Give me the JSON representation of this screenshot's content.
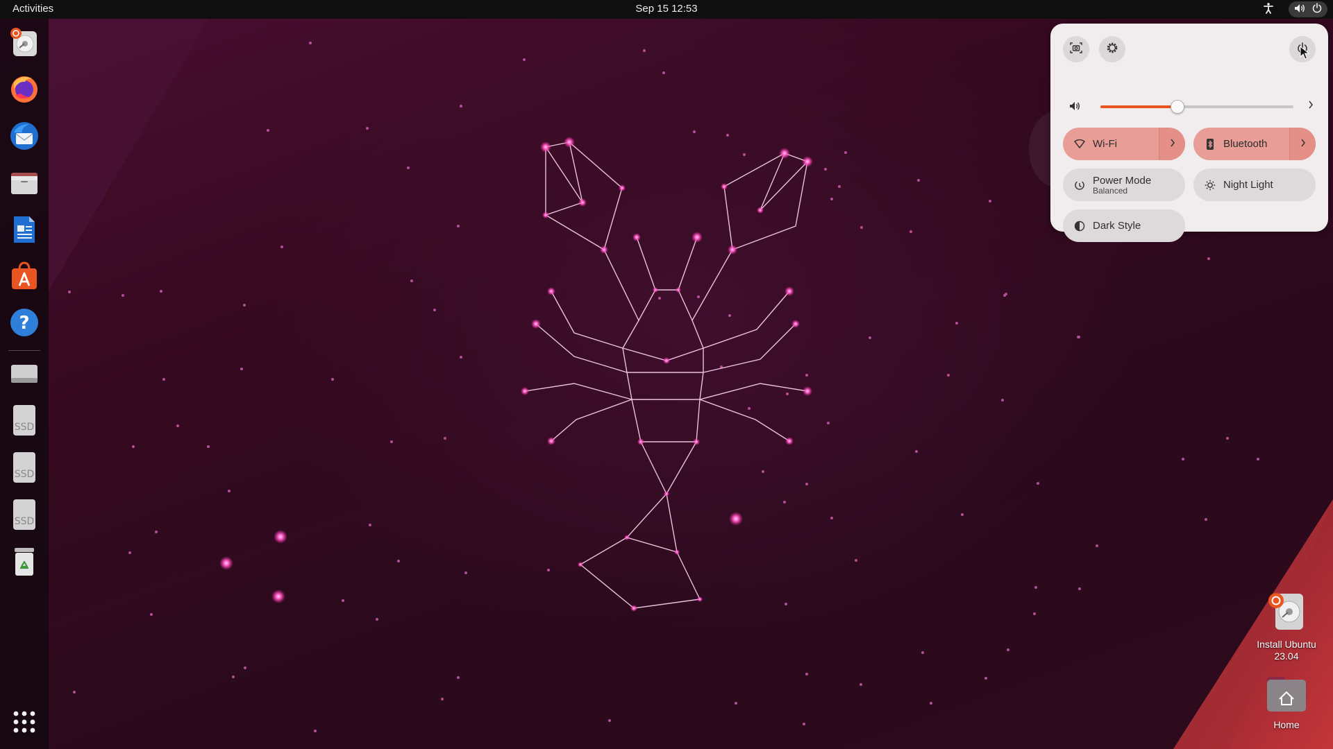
{
  "topbar": {
    "activities": "Activities",
    "datetime": "Sep 15  12:53"
  },
  "dock": {
    "items": [
      {
        "name": "Install Ubuntu",
        "icon": "ubuntu-installer-icon"
      },
      {
        "name": "Firefox",
        "icon": "firefox-icon"
      },
      {
        "name": "Thunderbird",
        "icon": "thunderbird-icon"
      },
      {
        "name": "Files",
        "icon": "files-icon"
      },
      {
        "name": "LibreOffice Writer",
        "icon": "writer-icon"
      },
      {
        "name": "App Center",
        "icon": "app-center-icon"
      },
      {
        "name": "Help",
        "icon": "help-icon"
      },
      {
        "name": "Drive",
        "icon": "drive-icon"
      },
      {
        "name": "SSD",
        "icon": "ssd-icon",
        "label": "SSD"
      },
      {
        "name": "SSD",
        "icon": "ssd-icon",
        "label": "SSD"
      },
      {
        "name": "SSD",
        "icon": "ssd-icon",
        "label": "SSD"
      },
      {
        "name": "Trash",
        "icon": "trash-icon"
      },
      {
        "name": "Show Apps",
        "icon": "app-grid-icon"
      }
    ]
  },
  "desktop": {
    "install_label": "Install Ubuntu 23.04",
    "home_label": "Home"
  },
  "quick_settings": {
    "volume_percent": 40,
    "wifi_label": "Wi-Fi",
    "bluetooth_label": "Bluetooth",
    "power_mode_label": "Power Mode",
    "power_mode_value": "Balanced",
    "night_light_label": "Night Light",
    "dark_style_label": "Dark Style"
  },
  "colors": {
    "accent": "#e95420",
    "toggle_on": "#e89e97",
    "panel_bg": "#f1edee"
  }
}
